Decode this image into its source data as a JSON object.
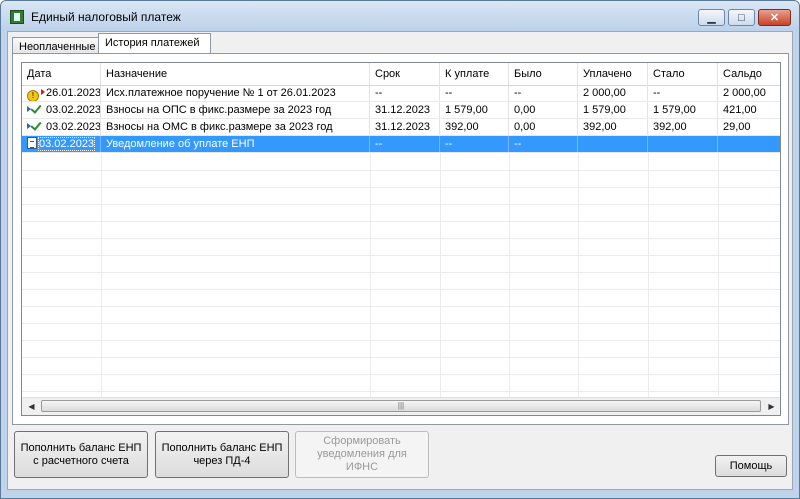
{
  "window": {
    "title": "Единый налоговый платеж"
  },
  "tabs": [
    {
      "label": "Неоплаченные"
    },
    {
      "label": "История платежей"
    }
  ],
  "grid": {
    "columns": [
      "Дата",
      "Назначение",
      "Срок",
      "К уплате",
      "Было",
      "Уплачено",
      "Стало",
      "Сальдо"
    ],
    "rows": [
      {
        "icon": "warning-icon",
        "date": "26.01.2023",
        "purpose": "Исх.платежное поручение № 1 от 26.01.2023",
        "due": "--",
        "to_pay": "--",
        "was": "--",
        "paid": "2 000,00",
        "became": "--",
        "balance": "2 000,00"
      },
      {
        "icon": "check-icon",
        "date": "03.02.2023",
        "purpose": "Взносы на ОПС в фикс.размере за 2023 год",
        "due": "31.12.2023",
        "to_pay": "1 579,00",
        "was": "0,00",
        "paid": "1 579,00",
        "became": "1 579,00",
        "balance": "421,00"
      },
      {
        "icon": "check-icon",
        "date": "03.02.2023",
        "purpose": "Взносы на ОМС в фикс.размере за 2023 год",
        "due": "31.12.2023",
        "to_pay": "392,00",
        "was": "0,00",
        "paid": "392,00",
        "became": "392,00",
        "balance": "29,00"
      },
      {
        "icon": "document-icon",
        "date": "03.02.2023",
        "purpose": "Уведомление об уплате ЕНП",
        "due": "--",
        "to_pay": "--",
        "was": "--",
        "paid": "",
        "became": "",
        "balance": "",
        "selected": true
      }
    ]
  },
  "buttons": {
    "top_up_account_line1": "Пополнить баланс ЕНП",
    "top_up_account_line2": "с расчетного счета",
    "top_up_pd4_line1": "Пополнить баланс ЕНП",
    "top_up_pd4_line2": "через ПД-4",
    "form_notice_line1": "Сформировать",
    "form_notice_line2": "уведомления для",
    "form_notice_line3": "ИФНС",
    "help": "Помощь"
  },
  "colors": {
    "selection": "#3399ff",
    "window_frame": "#bfd3ea"
  }
}
